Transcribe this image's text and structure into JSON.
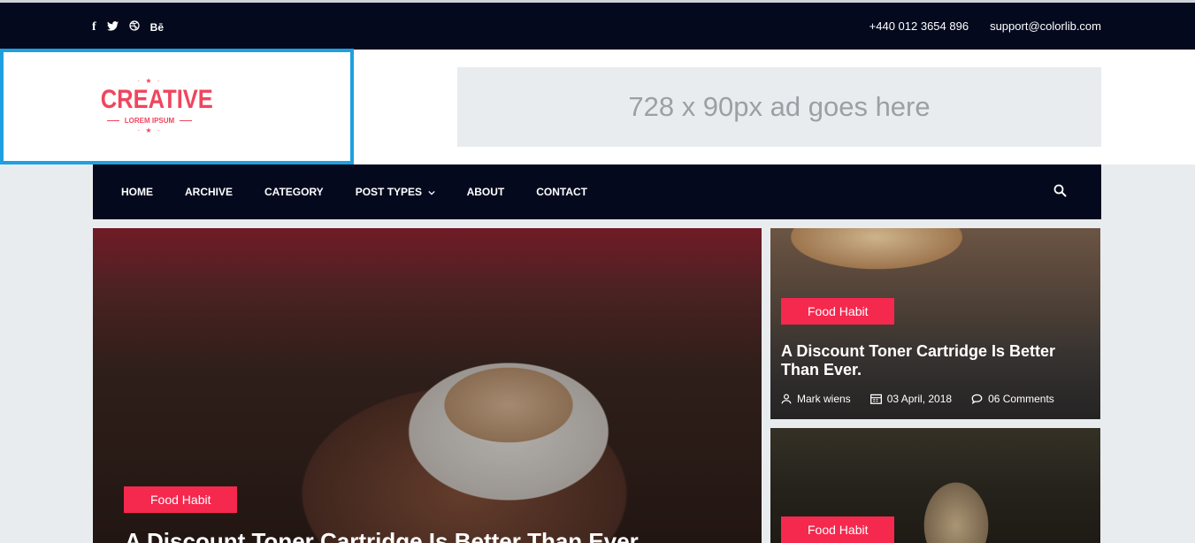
{
  "topbar": {
    "social": [
      {
        "icon": "facebook-icon",
        "glyph": "f"
      },
      {
        "icon": "twitter-icon",
        "glyph": "🐦"
      },
      {
        "icon": "dribbble-icon",
        "glyph": "◍"
      },
      {
        "icon": "behance-icon",
        "glyph": "Bē"
      }
    ],
    "phone": "+440 012 3654 896",
    "email": "support@colorlib.com"
  },
  "logo": {
    "name": "CREATIVE",
    "tagline": "LOREM IPSUM",
    "stars": "· ★ ·"
  },
  "ad": {
    "text": "728 x 90px ad goes here"
  },
  "nav": {
    "items": [
      "HOME",
      "ARCHIVE",
      "CATEGORY",
      "POST TYPES",
      "ABOUT",
      "CONTACT"
    ],
    "dropdown_caret": "⌄"
  },
  "hero": {
    "category": "Food Habit",
    "title": "A Discount Toner Cartridge Is Better Than Ever."
  },
  "side_posts": [
    {
      "category": "Food Habit",
      "title": "A Discount Toner Cartridge Is Better Than Ever.",
      "author": "Mark wiens",
      "date": "03 April, 2018",
      "comments": "06 Comments"
    },
    {
      "category": "Food Habit"
    }
  ],
  "colors": {
    "topbar": "#04091e",
    "accent": "#f5284e",
    "logo": "#f0455e",
    "highlight_border": "#1ea0e0"
  }
}
